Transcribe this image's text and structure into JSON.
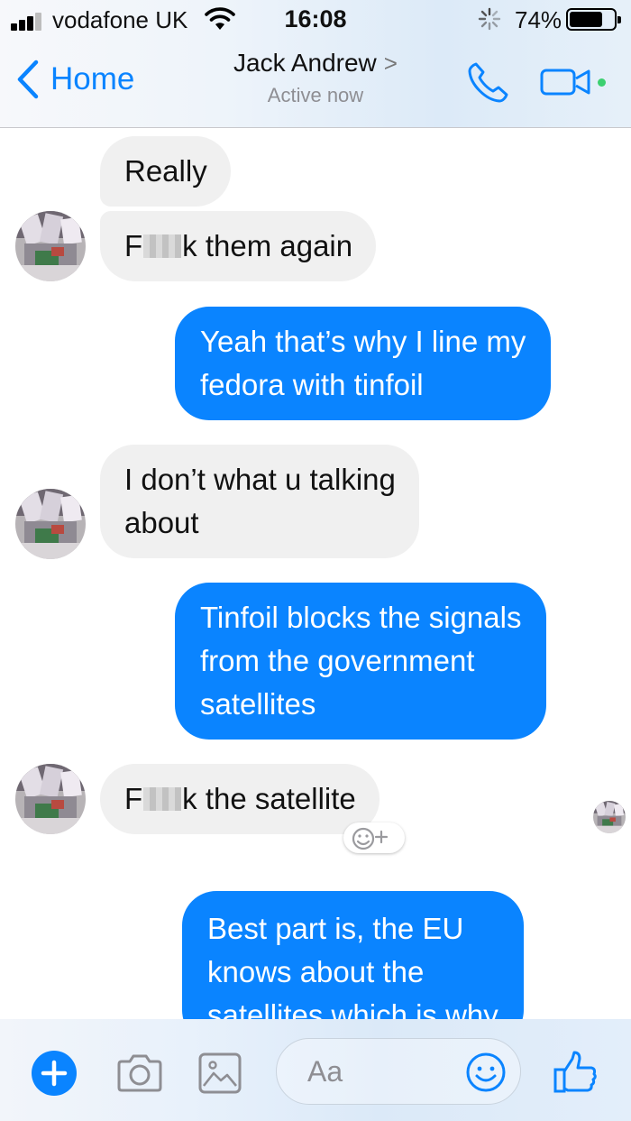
{
  "status_bar": {
    "carrier": "vodafone UK",
    "time": "16:08",
    "battery_percent_label": "74%",
    "battery_level": 0.74,
    "signal_bars": 3
  },
  "nav": {
    "back_label": "Home",
    "contact_name": "Jack Andrew",
    "contact_chevron": ">",
    "contact_status": "Active now"
  },
  "messages": [
    {
      "from": "them",
      "parts": [
        "Really"
      ]
    },
    {
      "from": "them",
      "parts": [
        "F",
        "[censored]",
        "k them again"
      ]
    },
    {
      "from": "me",
      "lines": [
        "Yeah that’s why I line my",
        "fedora with tinfoil"
      ]
    },
    {
      "from": "them",
      "lines": [
        "I don’t what u talking",
        "about"
      ]
    },
    {
      "from": "me",
      "lines": [
        "Tinfoil blocks the signals",
        "from the government",
        "satellites"
      ]
    },
    {
      "from": "them",
      "parts": [
        "F",
        "[censored]",
        "k the satellite"
      ]
    },
    {
      "from": "me",
      "lines": [
        "Best part is, the EU",
        "knows about the",
        "satellites which is why"
      ]
    }
  ],
  "composer": {
    "placeholder": "Aa"
  },
  "icons": {
    "back": "chevron-left-icon",
    "call": "phone-icon",
    "video": "video-camera-icon",
    "plus": "plus-icon",
    "camera": "camera-icon",
    "gallery": "image-icon",
    "emoji": "smiley-icon",
    "like": "thumbs-up-icon",
    "react": "add-reaction-icon"
  },
  "colors": {
    "accent": "#0a84ff",
    "incoming_bubble": "#f0f0f0",
    "online": "#3cd070"
  }
}
